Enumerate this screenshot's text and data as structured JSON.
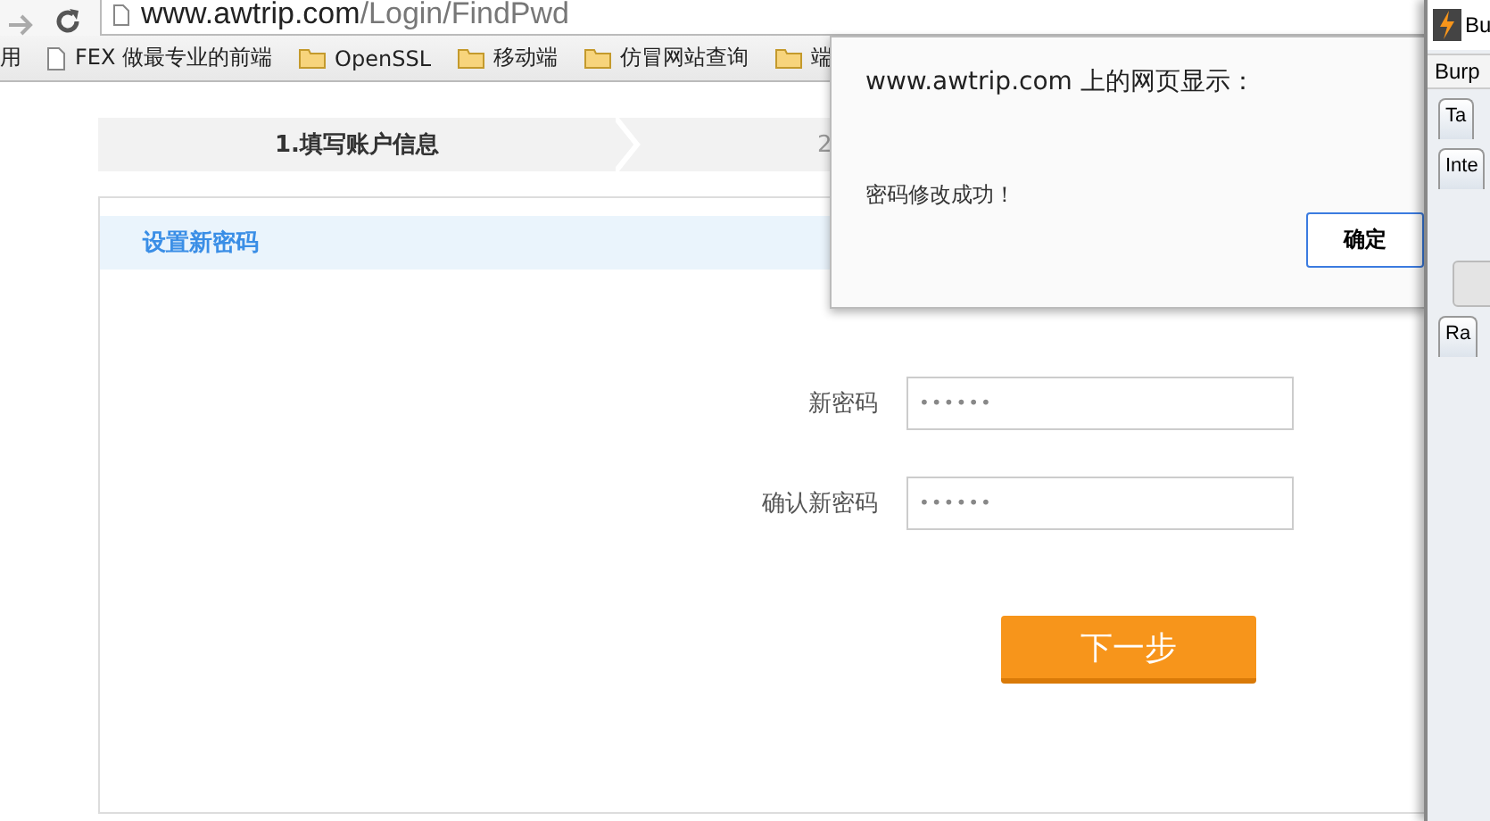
{
  "browser": {
    "address_host": "www.awtrip.com",
    "address_path": "/Login/FindPwd",
    "bookmarks": [
      {
        "label": "用",
        "kind": "text"
      },
      {
        "label": "FEX 做最专业的前端",
        "kind": "page"
      },
      {
        "label": "OpenSSL",
        "kind": "folder"
      },
      {
        "label": "移动端",
        "kind": "folder"
      },
      {
        "label": "仿冒网站查询",
        "kind": "folder"
      },
      {
        "label": "端",
        "kind": "folder"
      }
    ]
  },
  "steps": [
    {
      "label": "1.填写账户信息",
      "selected": true
    },
    {
      "label": "2",
      "selected": false
    }
  ],
  "section_title": "设置新密码",
  "fields": [
    {
      "label": "新密码",
      "value": "••••••"
    },
    {
      "label": "确认新密码",
      "value": "••••••"
    }
  ],
  "next_button": "下一步",
  "dialog": {
    "title": "www.awtrip.com 上的网页显示：",
    "message": "密码修改成功！",
    "ok_button": "确定"
  },
  "side_window": {
    "title": "Bu",
    "menu": "Burp",
    "tabs": [
      "Ta",
      "Inte"
    ],
    "subtab": "Ra"
  }
}
